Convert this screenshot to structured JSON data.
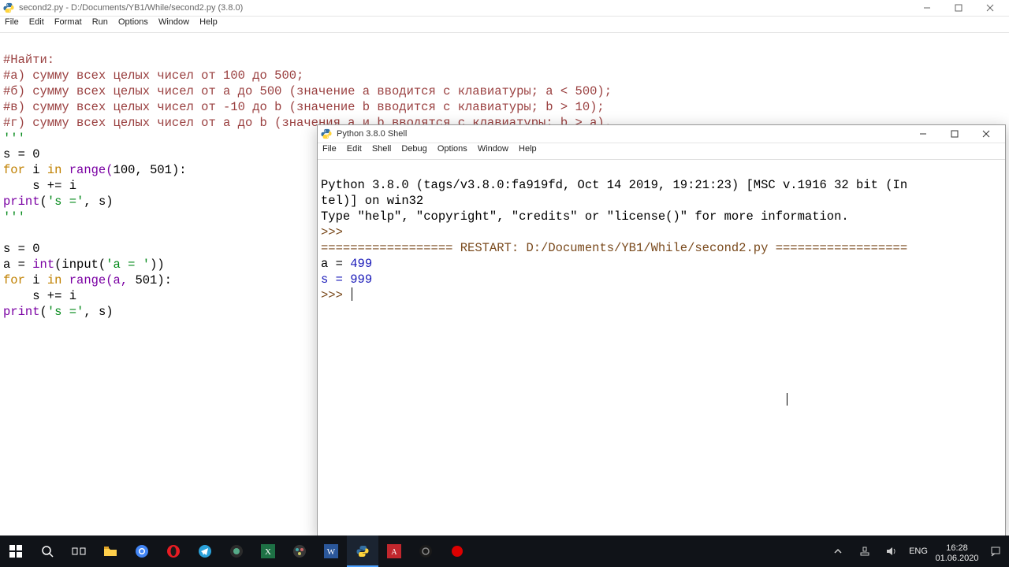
{
  "editor": {
    "title": "second2.py - D:/Documents/YB1/While/second2.py (3.8.0)",
    "menu": [
      "File",
      "Edit",
      "Format",
      "Run",
      "Options",
      "Window",
      "Help"
    ],
    "code": {
      "l1": "#Найти:",
      "l2": "#а) сумму всех целых чисел от 100 до 500;",
      "l3": "#б) сумму всех целых чисел от a до 500 (значение a вводится с клавиатуры; a < 500);",
      "l4": "#в) сумму всех целых чисел от -10 до b (значение b вводится с клавиатуры; b > 10);",
      "l5": "#г) сумму всех целых чисел от a до b (значения a и b вводятся с клавиатуры; b > a).",
      "q": "'''",
      "s0": "s = 0",
      "for1a": "for",
      "for1b": " i ",
      "for1c": "in",
      "for1d": " range(",
      "for1e": "100",
      "for1f": ", ",
      "for1g": "501",
      "for1h": "):",
      "body1": "    s += i",
      "pr_a": "print",
      "pr_b": "(",
      "pr_c": "'s ='",
      "pr_d": ", s)",
      "s0b": "s = 0",
      "a_eq": "a = ",
      "intk": "int",
      "inp": "(input(",
      "aeq": "'a = '",
      "cl": "))",
      "for2a": "for",
      "for2b": " i ",
      "for2c": "in",
      "for2d": " range(a, ",
      "for2e": "501",
      "for2f": "):",
      "body2": "    s += i",
      "pr2a": "print",
      "pr2b": "(",
      "pr2c": "'s ='",
      "pr2d": ", s)"
    }
  },
  "shell": {
    "title": "Python 3.8.0 Shell",
    "menu": [
      "File",
      "Edit",
      "Shell",
      "Debug",
      "Options",
      "Window",
      "Help"
    ],
    "out": {
      "l1": "Python 3.8.0 (tags/v3.8.0:fa919fd, Oct 14 2019, 19:21:23) [MSC v.1916 32 bit (In",
      "l2": "tel)] on win32",
      "l3": "Type \"help\", \"copyright\", \"credits\" or \"license()\" for more information.",
      "p1": ">>> ",
      "l4": "================== RESTART: D:/Documents/YB1/While/second2.py ==================",
      "l5": "a = ",
      "v5": "499",
      "l6": "s = ",
      "v6": "999",
      "p2": ">>> "
    }
  },
  "taskbar": {
    "lang": "ENG",
    "time": "16:28",
    "date": "01.06.2020"
  }
}
